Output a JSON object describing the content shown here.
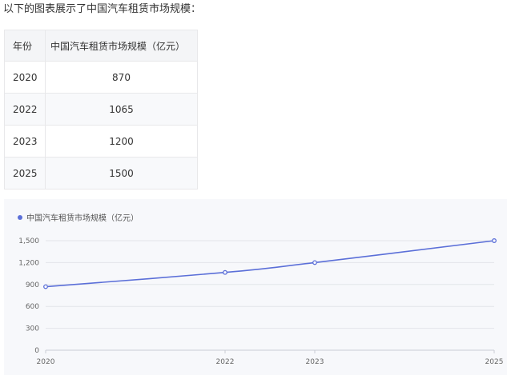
{
  "intro_text": "以下的图表展示了中国汽车租赁市场规模：",
  "table": {
    "headers": [
      "年份",
      "中国汽车租赁市场规模（亿元）"
    ],
    "rows": [
      [
        "2020",
        "870"
      ],
      [
        "2022",
        "1065"
      ],
      [
        "2023",
        "1200"
      ],
      [
        "2025",
        "1500"
      ]
    ]
  },
  "colors": {
    "series": "#5b6fd8",
    "grid": "#e3e5ea",
    "axis": "#c9ccd4"
  },
  "chart_data": {
    "type": "line",
    "x": [
      "2020",
      "2022",
      "2023",
      "2025"
    ],
    "series": [
      {
        "name": "中国汽车租赁市场规模（亿元）",
        "values": [
          870,
          1065,
          1200,
          1500
        ]
      }
    ],
    "ylim": [
      0,
      1500
    ],
    "yticks": [
      "0",
      "300",
      "600",
      "900",
      "1,200",
      "1,500"
    ],
    "legend": "top-left",
    "grid": true,
    "smooth": true
  }
}
